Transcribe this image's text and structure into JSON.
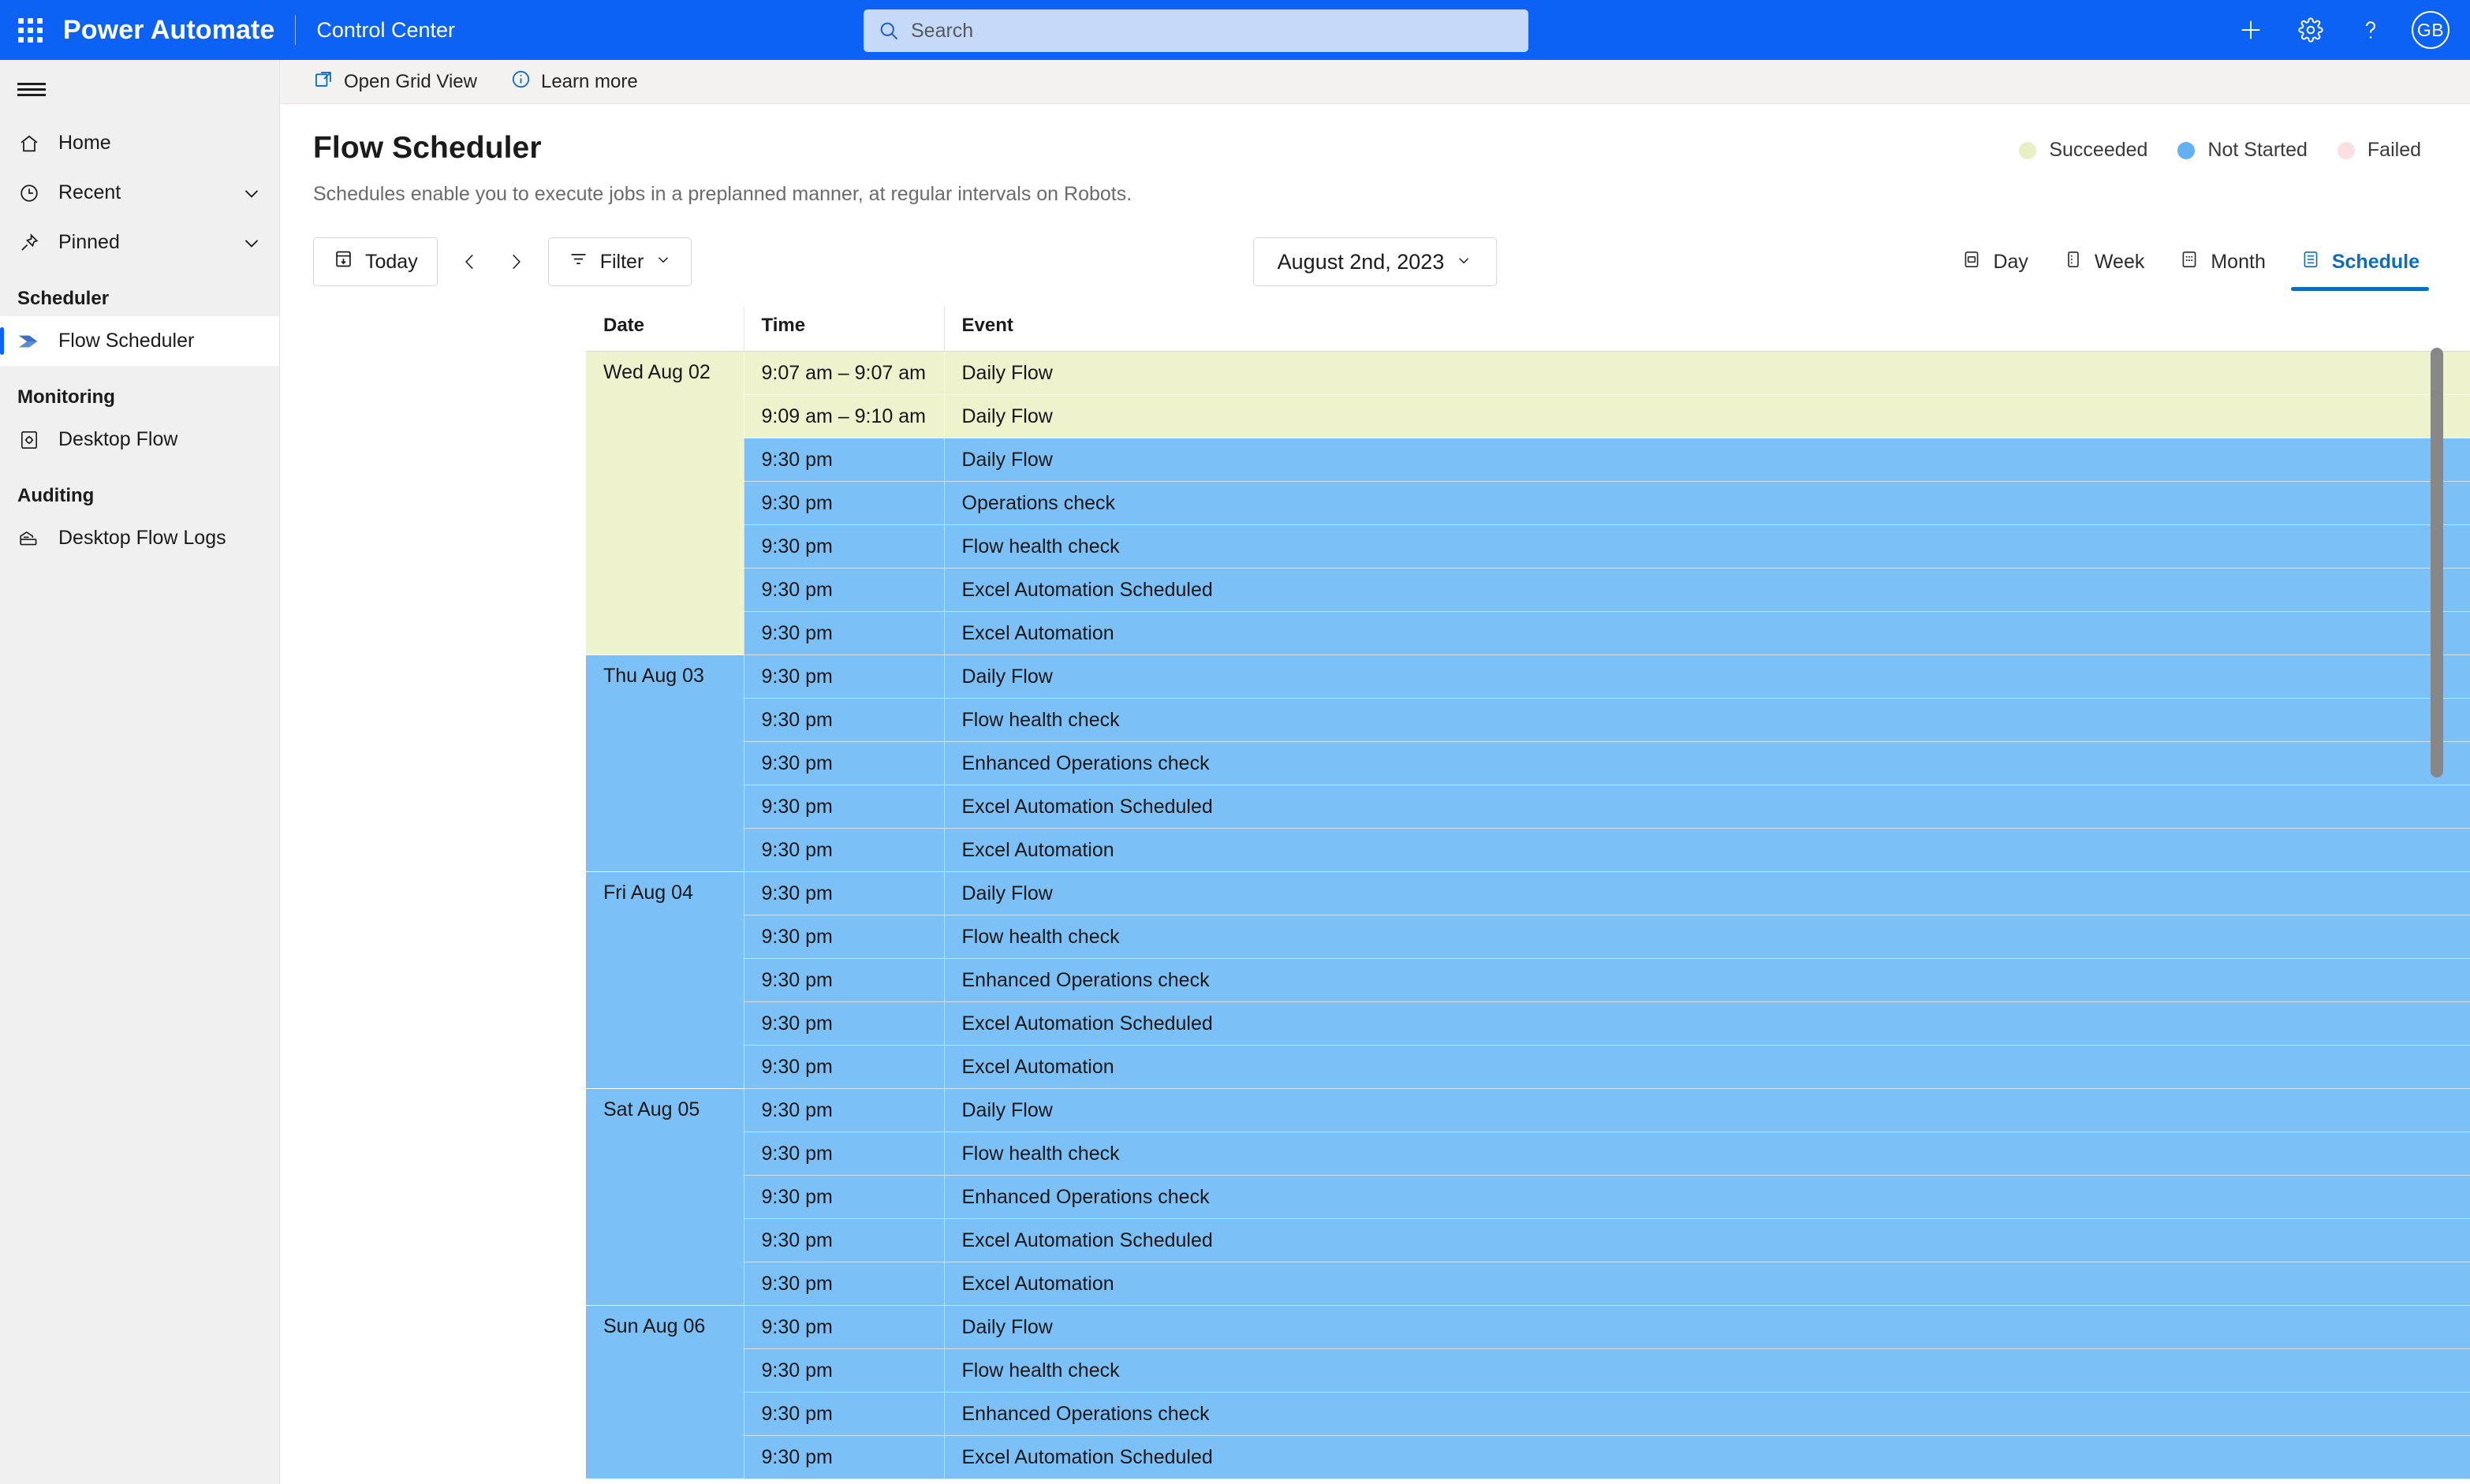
{
  "topbar": {
    "waffle_icon": "app-launcher-icon",
    "brand": "Power Automate",
    "app_name": "Control Center",
    "search": {
      "placeholder": "Search",
      "icon": "search-icon"
    },
    "add_icon": "plus-icon",
    "settings_icon": "gear-icon",
    "help_icon": "question-mark-icon",
    "avatar_initials": "GB"
  },
  "sidebar": {
    "hamburger_icon": "hamburger-menu-icon",
    "items": [
      {
        "label": "Home",
        "icon": "home-icon",
        "expandable": false
      },
      {
        "label": "Recent",
        "icon": "clock-icon",
        "expandable": true
      },
      {
        "label": "Pinned",
        "icon": "pin-icon",
        "expandable": true
      }
    ],
    "groups": [
      {
        "title": "Scheduler",
        "items": [
          {
            "label": "Flow Scheduler",
            "icon": "flow-icon",
            "active": true
          }
        ]
      },
      {
        "title": "Monitoring",
        "items": [
          {
            "label": "Desktop Flow",
            "icon": "desktop-flow-icon",
            "active": false
          }
        ]
      },
      {
        "title": "Auditing",
        "items": [
          {
            "label": "Desktop Flow Logs",
            "icon": "logs-icon",
            "active": false
          }
        ]
      }
    ]
  },
  "command_bar": {
    "open_grid_view": {
      "label": "Open Grid View",
      "icon": "open-in-new-icon"
    },
    "learn_more": {
      "label": "Learn more",
      "icon": "info-icon"
    }
  },
  "page": {
    "title": "Flow Scheduler",
    "subtitle": "Schedules enable you to execute jobs in a preplanned manner, at regular intervals on Robots."
  },
  "legend": [
    {
      "label": "Succeeded",
      "color": "#e8f0c3"
    },
    {
      "label": "Not Started",
      "color": "#62b1f6"
    },
    {
      "label": "Failed",
      "color": "#fbdfe4"
    }
  ],
  "toolbar": {
    "today": {
      "label": "Today",
      "icon": "calendar-today-icon"
    },
    "prev_icon": "chevron-left-icon",
    "next_icon": "chevron-right-icon",
    "filter": {
      "label": "Filter",
      "icon": "filter-icon",
      "chevron": "chevron-down-icon"
    },
    "date_picker": {
      "value": "August 2nd, 2023",
      "chevron": "chevron-down-icon"
    },
    "views": [
      {
        "label": "Day",
        "icon": "day-view-icon",
        "active": false
      },
      {
        "label": "Week",
        "icon": "week-view-icon",
        "active": false
      },
      {
        "label": "Month",
        "icon": "month-view-icon",
        "active": false
      },
      {
        "label": "Schedule",
        "icon": "schedule-view-icon",
        "active": true
      }
    ]
  },
  "schedule": {
    "columns": [
      "Date",
      "Time",
      "Event"
    ],
    "colors": {
      "succeeded_bg": "#eef2cd",
      "succeeded_accent": "#ffe600",
      "not_started_bg": "#7cc0f8",
      "not_started_accent": "#4a80a8"
    },
    "groups": [
      {
        "date": "Wed Aug 02",
        "date_status": "succeeded",
        "rows": [
          {
            "time": "9:07 am – 9:07 am",
            "event": "Daily Flow",
            "status": "succeeded"
          },
          {
            "time": "9:09 am – 9:10 am",
            "event": "Daily Flow",
            "status": "succeeded"
          },
          {
            "time": "9:30 pm",
            "event": "Daily Flow",
            "status": "not_started"
          },
          {
            "time": "9:30 pm",
            "event": "Operations check",
            "status": "not_started"
          },
          {
            "time": "9:30 pm",
            "event": "Flow health check",
            "status": "not_started"
          },
          {
            "time": "9:30 pm",
            "event": "Excel Automation Scheduled",
            "status": "not_started"
          },
          {
            "time": "9:30 pm",
            "event": "Excel Automation",
            "status": "not_started"
          }
        ]
      },
      {
        "date": "Thu Aug 03",
        "date_status": "not_started",
        "rows": [
          {
            "time": "9:30 pm",
            "event": "Daily Flow",
            "status": "not_started"
          },
          {
            "time": "9:30 pm",
            "event": "Flow health check",
            "status": "not_started"
          },
          {
            "time": "9:30 pm",
            "event": "Enhanced Operations check",
            "status": "not_started"
          },
          {
            "time": "9:30 pm",
            "event": "Excel Automation Scheduled",
            "status": "not_started"
          },
          {
            "time": "9:30 pm",
            "event": "Excel Automation",
            "status": "not_started"
          }
        ]
      },
      {
        "date": "Fri Aug 04",
        "date_status": "not_started",
        "rows": [
          {
            "time": "9:30 pm",
            "event": "Daily Flow",
            "status": "not_started"
          },
          {
            "time": "9:30 pm",
            "event": "Flow health check",
            "status": "not_started"
          },
          {
            "time": "9:30 pm",
            "event": "Enhanced Operations check",
            "status": "not_started"
          },
          {
            "time": "9:30 pm",
            "event": "Excel Automation Scheduled",
            "status": "not_started"
          },
          {
            "time": "9:30 pm",
            "event": "Excel Automation",
            "status": "not_started"
          }
        ]
      },
      {
        "date": "Sat Aug 05",
        "date_status": "not_started",
        "rows": [
          {
            "time": "9:30 pm",
            "event": "Daily Flow",
            "status": "not_started"
          },
          {
            "time": "9:30 pm",
            "event": "Flow health check",
            "status": "not_started"
          },
          {
            "time": "9:30 pm",
            "event": "Enhanced Operations check",
            "status": "not_started"
          },
          {
            "time": "9:30 pm",
            "event": "Excel Automation Scheduled",
            "status": "not_started"
          },
          {
            "time": "9:30 pm",
            "event": "Excel Automation",
            "status": "not_started"
          }
        ]
      },
      {
        "date": "Sun Aug 06",
        "date_status": "not_started",
        "rows": [
          {
            "time": "9:30 pm",
            "event": "Daily Flow",
            "status": "not_started"
          },
          {
            "time": "9:30 pm",
            "event": "Flow health check",
            "status": "not_started"
          },
          {
            "time": "9:30 pm",
            "event": "Enhanced Operations check",
            "status": "not_started"
          },
          {
            "time": "9:30 pm",
            "event": "Excel Automation Scheduled",
            "status": "not_started"
          }
        ]
      }
    ]
  }
}
